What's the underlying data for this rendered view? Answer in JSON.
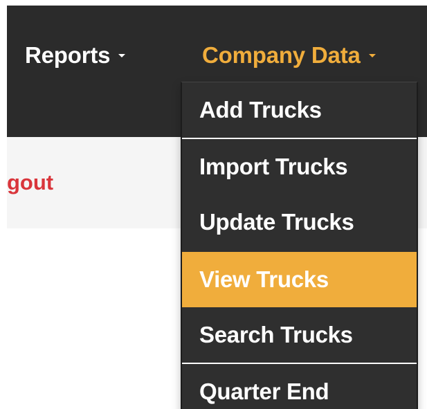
{
  "navbar": {
    "reports_label": "Reports",
    "company_data_label": "Company Data",
    "background_color": "#2b2b2b",
    "active_color": "#f0ad3c"
  },
  "subbar": {
    "logout_label": "gout",
    "logout_color": "#d9353b"
  },
  "dropdown": {
    "items": [
      {
        "label": "Add Trucks",
        "active": false
      },
      {
        "label": "Import Trucks",
        "active": false
      },
      {
        "label": "Update Trucks",
        "active": false
      },
      {
        "label": "View Trucks",
        "active": true
      },
      {
        "label": "Search Trucks",
        "active": false
      },
      {
        "label": "Quarter End",
        "active": false
      }
    ],
    "highlight_color": "#f0ad3c"
  }
}
